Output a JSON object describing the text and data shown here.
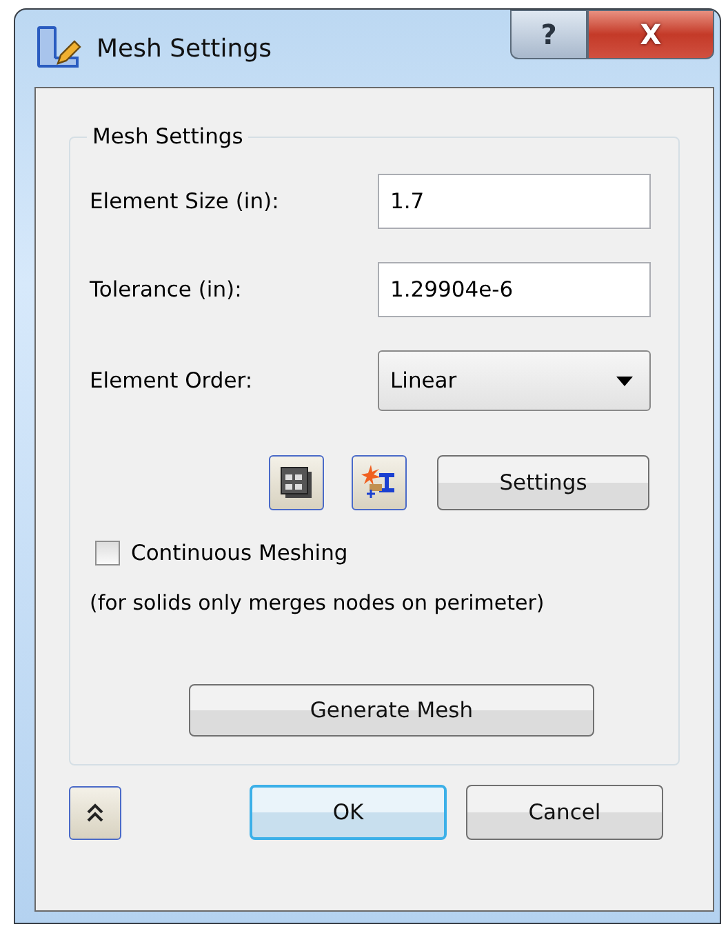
{
  "window": {
    "title": "Mesh Settings",
    "help_button": "?",
    "close_button": "X"
  },
  "group": {
    "title": "Mesh Settings",
    "fields": [
      {
        "kind": "text",
        "label": "Element Size (in):",
        "value": "1.7"
      },
      {
        "kind": "text",
        "label": "Tolerance (in):",
        "value": "1.29904e-6"
      },
      {
        "kind": "dropdown",
        "label": "Element Order:",
        "value": "Linear"
      }
    ],
    "settings_button": "Settings",
    "continuous_meshing": {
      "label": "Continuous Meshing",
      "checked": false
    },
    "note": "(for solids only merges nodes on perimeter)",
    "generate_button": "Generate Mesh"
  },
  "buttons": [
    {
      "label": "OK",
      "default": true
    },
    {
      "label": "Cancel",
      "default": false
    }
  ]
}
